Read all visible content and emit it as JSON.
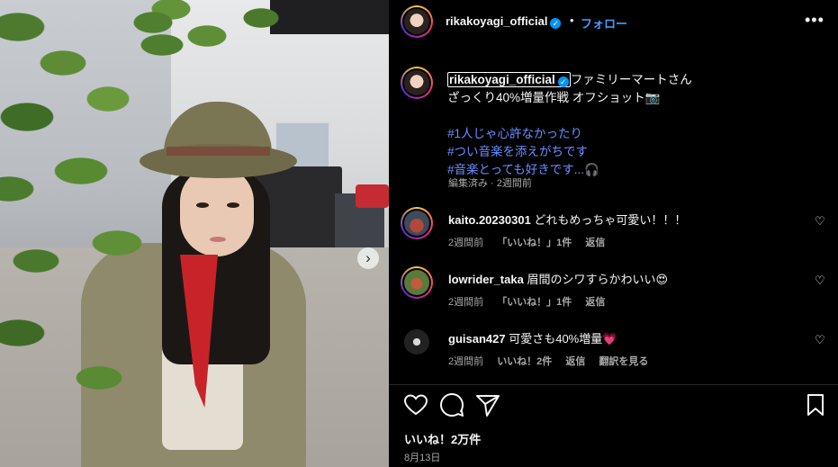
{
  "post": {
    "username": "rikakoyagi_official",
    "dot": "•",
    "follow_label": "フォロー",
    "more_label": "•••",
    "verified_icon": "✓",
    "caption": {
      "line1": "ファミリーマートさん",
      "line2": "ざっくり40%増量作戦 オフショット📷",
      "hashtags": [
        "#1人じゃ心許なかったり",
        "#つい音楽を添えがちです",
        "#音楽とっても好きです..."
      ],
      "hashtag_tail_icon": "🎧",
      "meta": "編集済み · 2週間前"
    },
    "likes": "いいね！2万件",
    "date": "8月13日",
    "next_arrow": "›"
  },
  "comments": [
    {
      "username": "kaito.20230301",
      "text": "どれもめっちゃ可愛い！！！",
      "time": "2週間前",
      "likes": "「いいね！」1件",
      "reply": "返信",
      "extra": ""
    },
    {
      "username": "lowrider_taka",
      "text": "眉間のシワすらかわいい😍",
      "time": "2週間前",
      "likes": "「いいね！」1件",
      "reply": "返信",
      "extra": ""
    },
    {
      "username": "guisan427",
      "text": "可愛さも40%増量💗",
      "time": "2週間前",
      "likes": "いいね！2件",
      "reply": "返信",
      "extra": "翻訳を見る"
    }
  ],
  "colors": {
    "accent_link": "#4a9bff",
    "hashtag": "#6a8eff",
    "verified": "#0095f6",
    "background": "#000000"
  }
}
